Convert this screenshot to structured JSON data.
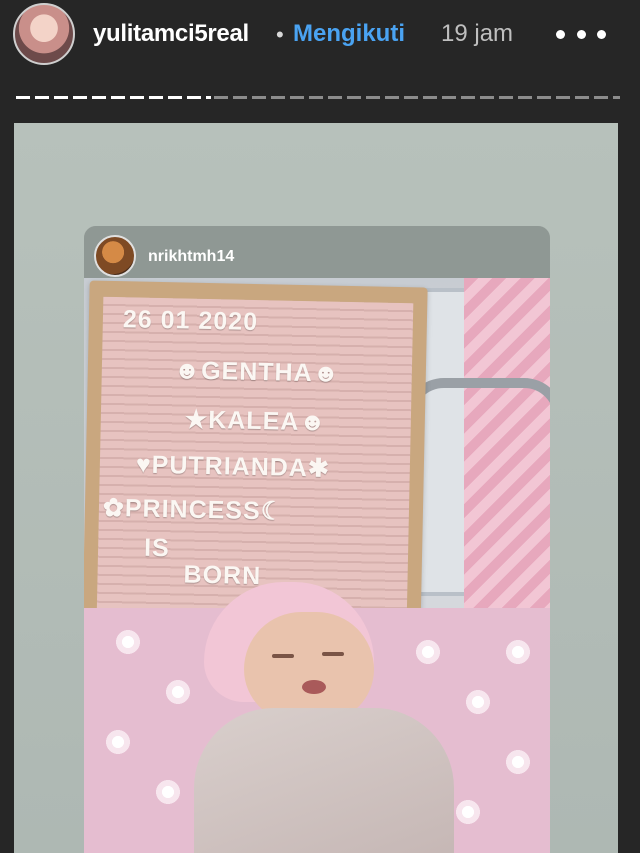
{
  "header": {
    "username": "yulitamci5real",
    "separator": "•",
    "follow_label": "Mengikuti",
    "time": "19 jam",
    "more_icon": "more-horizontal-icon"
  },
  "progress": {
    "current_segment_fraction": 0.33
  },
  "repost": {
    "username": "nrikhtmh14",
    "board_lines": [
      "26 01 2020",
      "☻GENTHA☻",
      "★KALEA☻",
      "♥PUTRIANDA✱",
      "✿PRINCESS☾",
      "IS",
      "BORN"
    ]
  },
  "colors": {
    "background": "#262626",
    "follow": "#4aa3f2",
    "username": "#ffffff",
    "time": "#bfbfbf"
  }
}
